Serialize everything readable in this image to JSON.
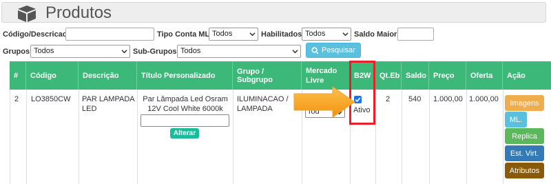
{
  "header": {
    "title": "Produtos",
    "icon": "cube-icon"
  },
  "filters": {
    "codigo_label": "Código/Descricao:",
    "codigo_value": "",
    "tipo_conta_label": "Tipo Conta ML:",
    "tipo_conta_value": "Todos",
    "habilitados_label": "Habilitados:",
    "habilitados_value": "Todos",
    "saldo_label": "Saldo Maior:",
    "saldo_value": "",
    "grupos_label": "Grupos:",
    "grupos_value": "Todos",
    "subgrupos_label": "Sub-Grupos:",
    "subgrupos_value": "Todos",
    "search_label": "Pesquisar"
  },
  "table": {
    "headers": [
      "#",
      "Código",
      "Descrição",
      "Título Personalizado",
      "Grupo / Subgrupo",
      "Mercado Livre",
      "B2W",
      "Qt.Eb",
      "Saldo",
      "Preço",
      "Oferta",
      "Ação"
    ],
    "row": {
      "num": "2",
      "codigo": "LO3850CW",
      "descricao": "PAR LAMPADA LED",
      "titulo": "Par Lâmpada Led Osram 12V Cool White 6000k",
      "titulo_input": "",
      "alterar": "Alterar",
      "grupo": "ILUMINACAO / LAMPADA",
      "ml_select": "Tod",
      "b2w_checked": true,
      "b2w_status": "Ativo",
      "qteb": "2",
      "saldo": "540",
      "preco": "1.000,00",
      "oferta": "1.000,00"
    },
    "actions": [
      "Imagens",
      "ML.",
      "Replica",
      "Est. Virt.",
      "Atributos"
    ]
  },
  "colors": {
    "table_header": "#3cb878",
    "highlight": "#e8202a",
    "arrow": "#f7a21b",
    "imagens": "#f0ad4e",
    "ml": "#5bc0de",
    "replica": "#5cb85c",
    "est_virt": "#337ab7",
    "atributos": "#8a5a0b"
  }
}
